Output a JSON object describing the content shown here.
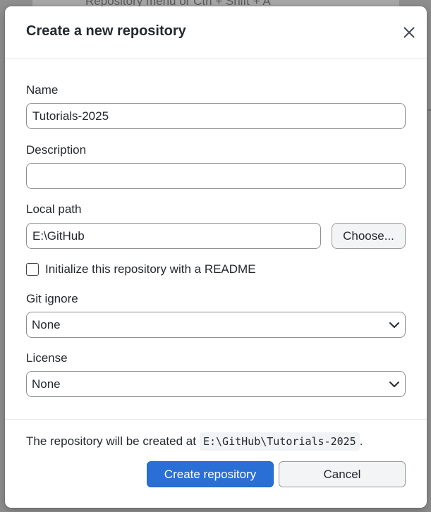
{
  "background": {
    "hint_text": "Repository menu or  Ctrl + Shift + A"
  },
  "dialog": {
    "title": "Create a new repository",
    "close_icon": "close-icon"
  },
  "form": {
    "name": {
      "label": "Name",
      "value": "Tutorials-2025"
    },
    "description": {
      "label": "Description",
      "value": ""
    },
    "local_path": {
      "label": "Local path",
      "value": "E:\\GitHub",
      "choose_label": "Choose..."
    },
    "readme": {
      "label": "Initialize this repository with a README",
      "checked": false
    },
    "git_ignore": {
      "label": "Git ignore",
      "selected": "None"
    },
    "license": {
      "label": "License",
      "selected": "None"
    }
  },
  "footer": {
    "note_prefix": "The repository will be created at",
    "note_path": "E:\\GitHub\\Tutorials-2025",
    "note_suffix": ".",
    "create_label": "Create repository",
    "cancel_label": "Cancel"
  },
  "colors": {
    "primary": "#2a6fd6",
    "text": "#24292e",
    "border": "#8d8d8d"
  }
}
